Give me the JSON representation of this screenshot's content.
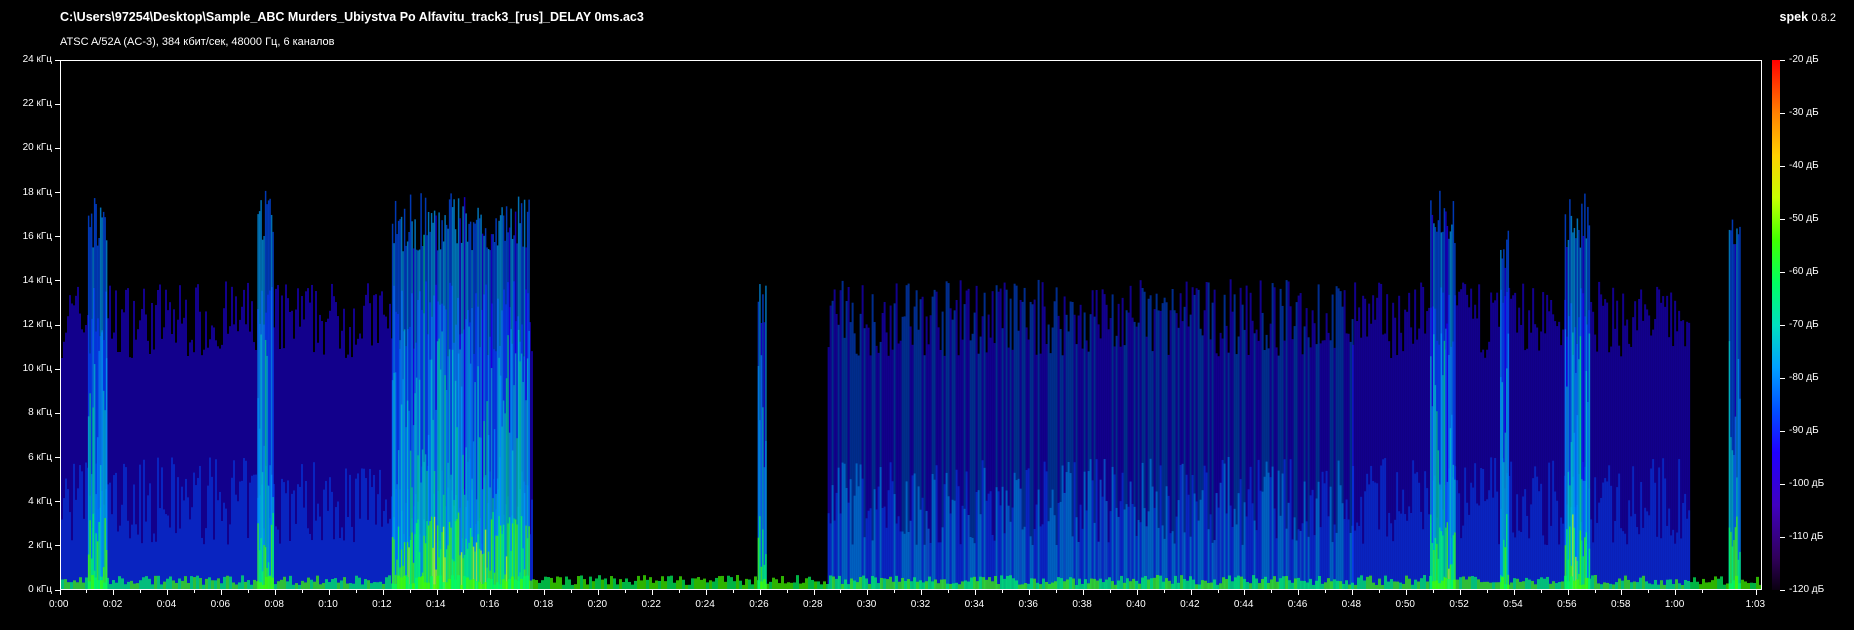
{
  "header": {
    "file_title": "C:\\Users\\97254\\Desktop\\Sample_ABC Murders_Ubiystva Po Alfavitu_track3_[rus]_DELAY 0ms.ac3",
    "file_info": "ATSC A/52A (AC-3), 384 кбит/сек, 48000 Гц, 6 каналов",
    "app_name": "spek",
    "app_version": "0.8.2"
  },
  "chart_data": {
    "type": "heatmap",
    "title": "",
    "x_ticks": [
      "0:00",
      "0:02",
      "0:04",
      "0:06",
      "0:08",
      "0:10",
      "0:12",
      "0:14",
      "0:16",
      "0:18",
      "0:20",
      "0:22",
      "0:24",
      "0:26",
      "0:28",
      "0:30",
      "0:32",
      "0:34",
      "0:36",
      "0:38",
      "0:40",
      "0:42",
      "0:44",
      "0:46",
      "0:48",
      "0:50",
      "0:52",
      "0:54",
      "0:56",
      "0:58",
      "1:00",
      "1:03"
    ],
    "x_tick_seconds": [
      0,
      2,
      4,
      6,
      8,
      10,
      12,
      14,
      16,
      18,
      20,
      22,
      24,
      26,
      28,
      30,
      32,
      34,
      36,
      38,
      40,
      42,
      44,
      46,
      48,
      50,
      52,
      54,
      56,
      58,
      60,
      63
    ],
    "x_range_seconds": [
      0,
      63.2
    ],
    "y_ticks": [
      "0 кГц",
      "2 кГц",
      "4 кГц",
      "6 кГц",
      "8 кГц",
      "10 кГц",
      "12 кГц",
      "14 кГц",
      "16 кГц",
      "18 кГц",
      "20 кГц",
      "22 кГц",
      "24 кГц"
    ],
    "y_tick_khz": [
      0,
      2,
      4,
      6,
      8,
      10,
      12,
      14,
      16,
      18,
      20,
      22,
      24
    ],
    "y_range_khz": [
      0,
      24
    ],
    "colorbar_ticks": [
      "-20 дБ",
      "-30 дБ",
      "-40 дБ",
      "-50 дБ",
      "-60 дБ",
      "-70 дБ",
      "-80 дБ",
      "-90 дБ",
      "-100 дБ",
      "-110 дБ",
      "-120 дБ"
    ],
    "colorbar_db": [
      -20,
      -30,
      -40,
      -50,
      -60,
      -70,
      -80,
      -90,
      -100,
      -110,
      -120
    ],
    "colorbar_range_db": [
      -120,
      -20
    ],
    "colors": [
      "#0a0010",
      "#30005a",
      "#4000c0",
      "#2000ff",
      "#0050ff",
      "#00a0ff",
      "#00e0c0",
      "#00ff60",
      "#40ff00",
      "#c8ff00",
      "#ffd000",
      "#ff8000",
      "#ff0000"
    ],
    "bursts": [
      {
        "start": 1.0,
        "end": 1.7,
        "max_khz": 18,
        "intensity": 0.8
      },
      {
        "start": 7.3,
        "end": 7.9,
        "max_khz": 18.2,
        "intensity": 0.75
      },
      {
        "start": 12.3,
        "end": 17.4,
        "max_khz": 18,
        "intensity": 0.9
      },
      {
        "start": 25.9,
        "end": 26.2,
        "max_khz": 14,
        "intensity": 0.6
      },
      {
        "start": 50.9,
        "end": 51.8,
        "max_khz": 18.2,
        "intensity": 0.85
      },
      {
        "start": 53.5,
        "end": 53.8,
        "max_khz": 16.8,
        "intensity": 0.6
      },
      {
        "start": 55.9,
        "end": 56.8,
        "max_khz": 18.2,
        "intensity": 0.85
      },
      {
        "start": 62.0,
        "end": 62.4,
        "max_khz": 17.2,
        "intensity": 0.7
      }
    ],
    "activity_regions": [
      {
        "start": 0.0,
        "end": 17.5,
        "max_khz": 14,
        "level": 0.35
      },
      {
        "start": 28.5,
        "end": 48.0,
        "max_khz": 14.1,
        "level": 0.55
      },
      {
        "start": 48.0,
        "end": 60.5,
        "max_khz": 14,
        "level": 0.35
      }
    ]
  }
}
